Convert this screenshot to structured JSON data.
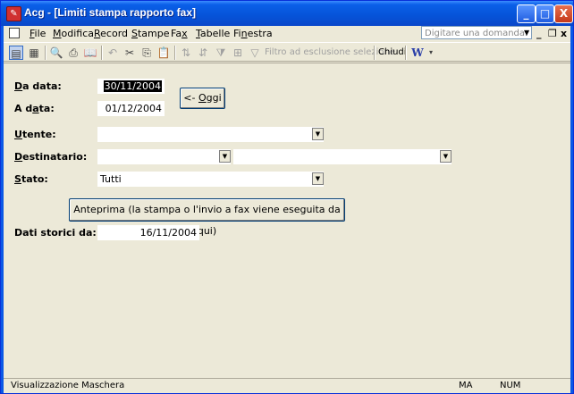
{
  "window": {
    "title": "Acg - [Limiti stampa rapporto fax]",
    "controls": {
      "minimize": "_",
      "maximize": "□",
      "close": "X"
    }
  },
  "menubar": {
    "items": [
      {
        "label": "File",
        "accel": "F",
        "rest": "ile"
      },
      {
        "label": "Modifica",
        "accel": "M",
        "rest": "odifica"
      },
      {
        "label": "Record",
        "accel": "R",
        "rest": "ecord"
      },
      {
        "label": "Stampe",
        "accel": "S",
        "rest": "tampe"
      },
      {
        "label": "Fax",
        "pre": "Fa",
        "accel": "x",
        "rest": ""
      },
      {
        "label": "Tabelle",
        "accel": "T",
        "rest": "abelle"
      },
      {
        "label": "Finestra",
        "pre": "Fi",
        "accel": "n",
        "rest": "estra"
      }
    ],
    "help_placeholder": "Digitare una domanda.",
    "mdi": {
      "minimize": "_",
      "restore": "❐",
      "close": "x"
    }
  },
  "toolbar": {
    "filter_label": "Filtro ad esclusione selezione",
    "close_label": "Chiudi"
  },
  "form": {
    "da_data": {
      "label": "Da data:",
      "value": "30/11/2004"
    },
    "a_data": {
      "label": "A data:",
      "value": "01/12/2004"
    },
    "oggi_button": "<- Oggi",
    "utente": {
      "label": "Utente:",
      "value": ""
    },
    "destinatario": {
      "label": "Destinatario:",
      "value1": "",
      "value2": ""
    },
    "stato": {
      "label": "Stato:",
      "value": "Tutti"
    },
    "anteprima_button": "Anteprima (la stampa o l'invio a fax viene eseguita da qui)",
    "dati_storici": {
      "label": "Dati storici da:",
      "value": "16/11/2004"
    }
  },
  "statusbar": {
    "text": "Visualizzazione Maschera",
    "ind1": "MA",
    "ind2": "NUM"
  }
}
